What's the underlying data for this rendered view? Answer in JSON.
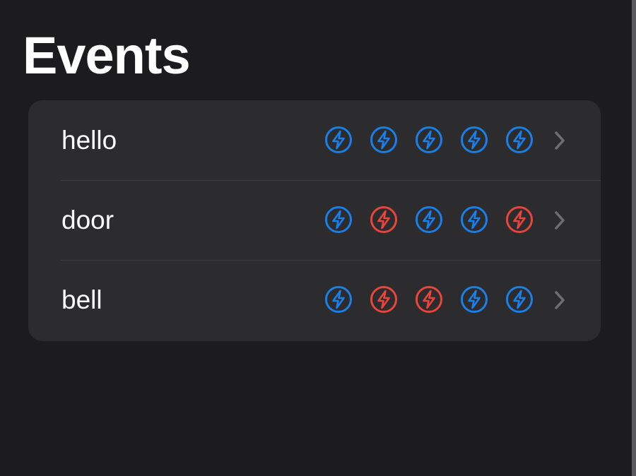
{
  "page": {
    "title": "Events"
  },
  "colors": {
    "background": "#1c1c1e",
    "card": "#2c2c2e",
    "active": "#1a7fe8",
    "triggered": "#e8453c",
    "chevron": "#6e6e73"
  },
  "events": [
    {
      "label": "hello",
      "indicators": [
        "blue",
        "blue",
        "blue",
        "blue",
        "blue"
      ]
    },
    {
      "label": "door",
      "indicators": [
        "blue",
        "red",
        "blue",
        "blue",
        "red"
      ]
    },
    {
      "label": "bell",
      "indicators": [
        "blue",
        "red",
        "red",
        "blue",
        "blue"
      ]
    }
  ],
  "icons": {
    "indicator": "bolt-circle-icon",
    "chevron": "chevron-right-icon"
  }
}
